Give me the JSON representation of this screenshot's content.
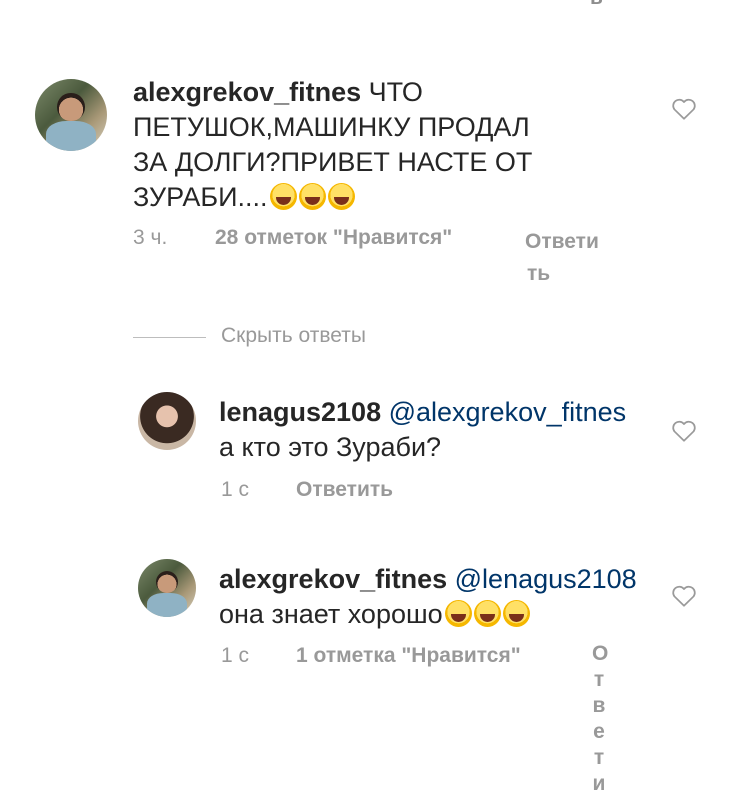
{
  "top_fragment": "ь",
  "comments": [
    {
      "username": "alexgrekov_fitnes",
      "text_line1": "ЧТО",
      "text_line2": "ПЕТУШОК,МАШИНКУ ПРОДАЛ",
      "text_line3": "ЗА ДОЛГИ?ПРИВЕТ НАСТЕ ОТ",
      "text_line4": "ЗУРАБИ....",
      "emoji_count": 3,
      "time": "3 ч.",
      "likes": "28 отметок \"Нравится\"",
      "reply_line1": "Ответи",
      "reply_line2": "ть"
    },
    {
      "username": "lenagus2108",
      "mention": "@alexgrekov_fitnes",
      "text": "а кто это Зураби?",
      "time": "1 с",
      "reply": "Ответить"
    },
    {
      "username": "alexgrekov_fitnes",
      "mention": "@lenagus2108",
      "text": "она знает хорошо",
      "emoji_count": 3,
      "time": "1 с",
      "likes": "1 отметка \"Нравится\"",
      "reply_vertical": [
        "О",
        "т",
        "в",
        "е",
        "т",
        "и"
      ]
    }
  ],
  "hide_replies": "Скрыть ответы",
  "icons": {
    "like": "heart-outline-icon",
    "emoji": "tears-of-joy-emoji"
  }
}
